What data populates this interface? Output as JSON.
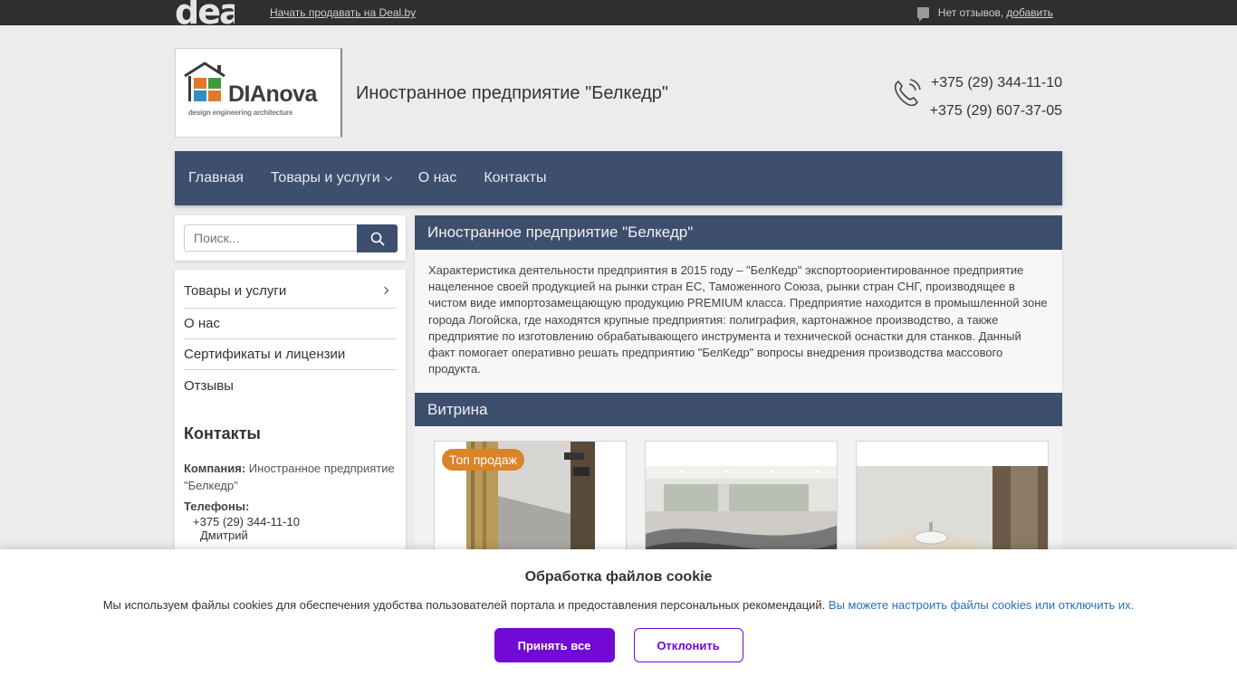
{
  "topbar": {
    "logo": "deal",
    "sell_link": "Начать продавать на Deal.by",
    "reviews_text": "Нет отзывов,",
    "reviews_add": "добавить"
  },
  "header": {
    "logo_brand": "DIAnova",
    "logo_tag": "design engineering architecture",
    "company_title": "Иностранное предприятие \"Белкедр\"",
    "phones": [
      "+375 (29) 344-11-10",
      "+375 (29) 607-37-05"
    ]
  },
  "nav": {
    "items": [
      "Главная",
      "Товары и услуги",
      "О нас",
      "Контакты"
    ]
  },
  "search": {
    "placeholder": "Поиск..."
  },
  "sidebar": {
    "menu": [
      "Товары и услуги",
      "О нас",
      "Сертификаты и лицензии",
      "Отзывы"
    ],
    "contacts_title": "Контакты",
    "company_label": "Компания:",
    "company_value": "Иностранное предприятие \"Белкедр\"",
    "phones_label": "Телефоны:",
    "phone": "+375 (29) 344-11-10",
    "person": "Дмитрий"
  },
  "main": {
    "title": "Иностранное предприятие \"Белкедр\"",
    "description": "Характеристика деятельности предприятия в 2015 году – \"БелКедр\" экспортоориентированное предприятие нацеленное своей продукцией на рынки стран ЕС, Таможенного Союза, рынки стран СНГ, производящее в чистом виде импортозамещающую продукцию PREMIUM класса. Предприятие находится в промышленной зоне города Логойска, где находятся крупные предприятия: полиграфия, картонажное производство, а также предприятие по изготовлению обрабатывающего инструмента и технической оснастки для станков. Данный факт помогает оперативно решать предприятию \"БелКедр\" вопросы внедрения производства массового продукта.",
    "showcase_title": "Витрина",
    "badge": "Топ продаж"
  },
  "cookie": {
    "title": "Обработка файлов cookie",
    "text": "Мы используем файлы cookies для обеспечения удобства пользователей портала и предоставления персональных рекомендаций.",
    "link": "Вы можете настроить файлы cookies или отключить их.",
    "accept": "Принять все",
    "decline": "Отклонить"
  },
  "colors": {
    "nav_bg": "#3e4f6d",
    "topbar_bg": "#2f2f2f",
    "accent_purple": "#7209d4",
    "badge_orange": "#d9832a"
  }
}
